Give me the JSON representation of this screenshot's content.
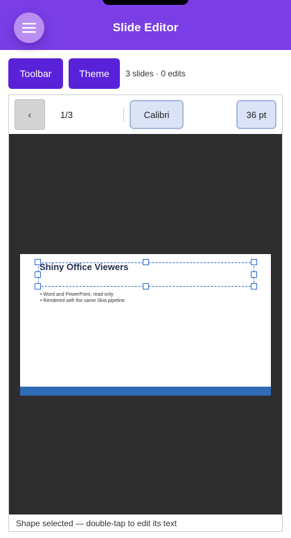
{
  "app": {
    "title": "Slide Editor"
  },
  "header": {
    "menu_icon": "hamburger-icon"
  },
  "actions": {
    "toolbar_label": "Toolbar",
    "theme_label": "Theme",
    "summary": "3 slides · 0 edits"
  },
  "toolbar": {
    "prev_label": "‹",
    "page_indicator": "1/3",
    "font_name": "Calibri",
    "font_size": "36 pt"
  },
  "slide": {
    "title": "Shiny Office Viewers",
    "bullets": [
      "Word and PowerPoint, read-only",
      "Rendered with the same Skia pipeline"
    ]
  },
  "status": {
    "message": "Shape selected — double-tap to edit its text"
  },
  "colors": {
    "topbar": "#7a3de6",
    "pill": "#5a22d8",
    "selection": "#2f6bd1",
    "slide_footer": "#2f6bb4"
  }
}
